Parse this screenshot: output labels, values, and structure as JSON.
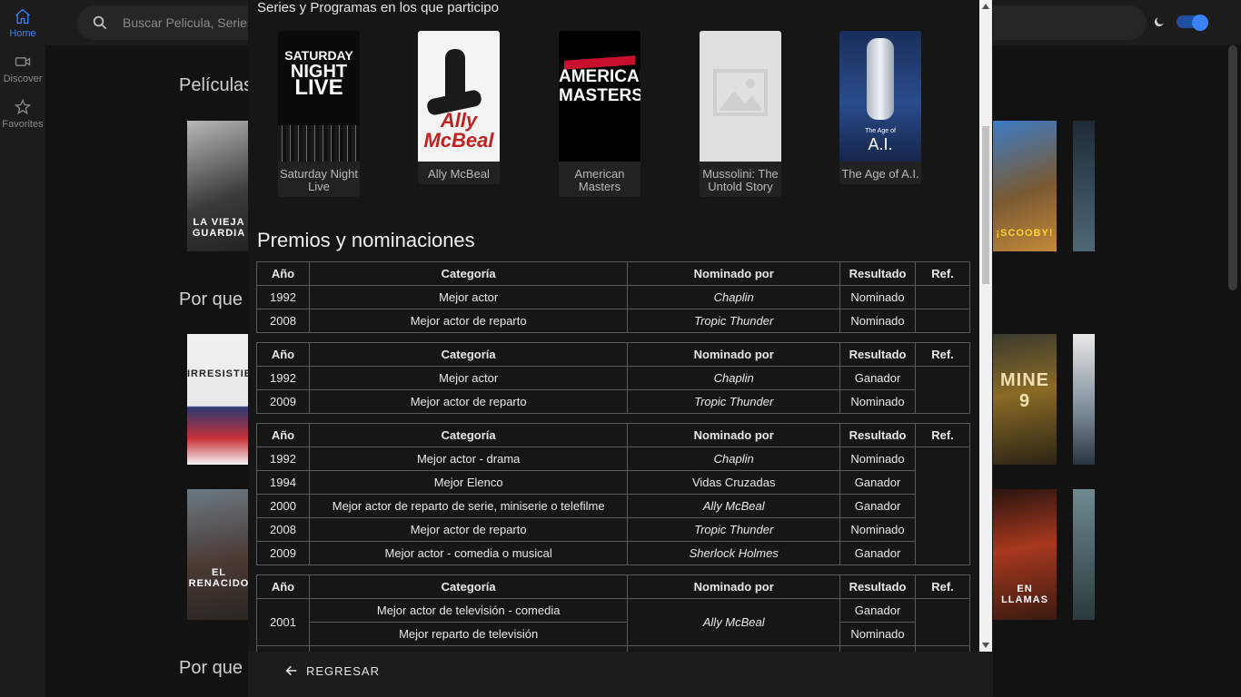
{
  "sidebar": {
    "items": [
      {
        "label": "Home",
        "icon": "home-icon",
        "active": true
      },
      {
        "label": "Discover",
        "icon": "video-icon",
        "active": false
      },
      {
        "label": "Favorites",
        "icon": "star-icon",
        "active": false
      }
    ]
  },
  "search": {
    "placeholder": "Buscar Pelicula, Series"
  },
  "theme": {
    "dark_mode": true,
    "accent": "#3b82f6"
  },
  "background": {
    "sections": [
      "Películas",
      "Por que",
      "Por que"
    ],
    "posters": [
      "LA VIEJA GUARDIA",
      "IRRESISTIBLE",
      "EL RENACIDO",
      "¡SCOOBY!",
      "MINE 9",
      "EN LLAMAS"
    ]
  },
  "modal": {
    "series_heading": "Series y Programas en los que participo",
    "series": [
      {
        "title": "Saturday Night Live"
      },
      {
        "title": "Ally McBeal"
      },
      {
        "title": "American Masters"
      },
      {
        "title": "Mussolini: The Untold Story"
      },
      {
        "title": "The Age of A.I."
      }
    ],
    "poster_text": {
      "snl": [
        "SATURDAY",
        "NIGHT",
        "LIVE"
      ],
      "ally": [
        "Ally",
        "McBeal"
      ],
      "am": [
        "AMERICAN",
        "MASTERS"
      ],
      "ai": [
        "The Age of",
        "A.I."
      ]
    },
    "awards_title": "Premios y nominaciones",
    "headers": {
      "year": "Año",
      "category": "Categoría",
      "nominated_by": "Nominado por",
      "result": "Resultado",
      "ref": "Ref."
    },
    "tables": [
      {
        "rows": [
          {
            "year": "1992",
            "category": "Mejor actor",
            "nominated_by": "Chaplin",
            "result": "Nominado"
          },
          {
            "year": "2008",
            "category": "Mejor actor de reparto",
            "nominated_by": "Tropic Thunder",
            "result": "Nominado"
          }
        ]
      },
      {
        "rows": [
          {
            "year": "1992",
            "category": "Mejor actor",
            "nominated_by": "Chaplin",
            "result": "Ganador"
          },
          {
            "year": "2009",
            "category": "Mejor actor de reparto",
            "nominated_by": "Tropic Thunder",
            "result": "Nominado"
          }
        ]
      },
      {
        "rows": [
          {
            "year": "1992",
            "category": "Mejor actor - drama",
            "nominated_by": "Chaplin",
            "result": "Nominado"
          },
          {
            "year": "1994",
            "category": "Mejor Elenco",
            "nominated_by": "Vidas Cruzadas",
            "result": "Ganador"
          },
          {
            "year": "2000",
            "category": "Mejor actor de reparto de serie, miniserie o telefilme",
            "nominated_by": "Ally McBeal",
            "result": "Ganador"
          },
          {
            "year": "2008",
            "category": "Mejor actor de reparto",
            "nominated_by": "Tropic Thunder",
            "result": "Nominado"
          },
          {
            "year": "2009",
            "category": "Mejor actor - comedia o musical",
            "nominated_by": "Sherlock Holmes",
            "result": "Ganador"
          }
        ]
      },
      {
        "rows": [
          {
            "year": "2001",
            "category": "Mejor actor de televisión - comedia",
            "nominated_by": "Ally McBeal",
            "result": "Ganador"
          },
          {
            "year": "",
            "category": "Mejor reparto de televisión",
            "nominated_by": "",
            "result": "Nominado"
          }
        ]
      }
    ],
    "back_label": "REGRESAR"
  }
}
